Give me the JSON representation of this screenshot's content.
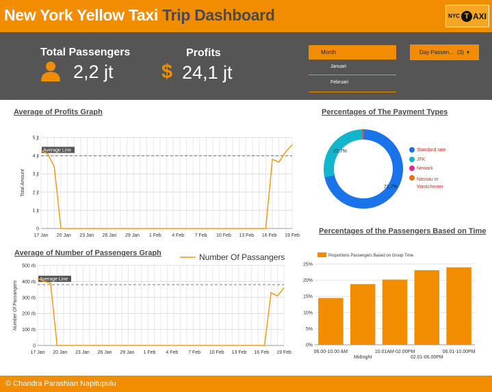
{
  "header": {
    "title_main": "New York Yellow Taxi",
    "title_accent": "Trip Dashboard",
    "logo_left": "NYC",
    "logo_t": "T",
    "logo_right": "AXI"
  },
  "kpis": {
    "passengers_label": "Total Passengers",
    "passengers_value": "2,2 jt",
    "profits_label": "Profits",
    "profits_symbol": "$",
    "profits_value": "24,1 jt"
  },
  "filters": {
    "month_label": "Month",
    "month_options": [
      "Januari",
      "Februari"
    ],
    "day_label": "Day Passen...",
    "day_count": "(3)",
    "day_arrow": "▾"
  },
  "sections": {
    "profits_title": "Average of Profits Graph",
    "passengers_title": "Average of Number of Passengers Graph",
    "payment_title": "Percentages of The Payment Types",
    "time_title": "Percentages of the Passengers Based on Time"
  },
  "payment_legend": [
    "Standard rate",
    "JFK",
    "Newark",
    "Nassau or Westchester"
  ],
  "colors": {
    "accent": "#f28c00",
    "band": "#555555",
    "line": "#f39c12",
    "bar": "#f28c00",
    "standard_rate": "#1a73e8",
    "jfk": "#12b5cb",
    "newark": "#e52592",
    "nassau": "#e8710a"
  },
  "footer": {
    "text": "© Chandra Parashian Napitupulu"
  },
  "chart_data": [
    {
      "type": "line",
      "ylabel": "Total Amount",
      "yticks": [
        "0",
        "1 jt",
        "2 jt",
        "3 jt",
        "4 jt",
        "5 jt"
      ],
      "ylim": [
        0,
        5
      ],
      "xticks": [
        "17 Jan",
        "20 Jan",
        "23 Jan",
        "26 Jan",
        "29 Jan",
        "1 Feb",
        "4 Feb",
        "7 Feb",
        "10 Feb",
        "13 Feb",
        "16 Feb",
        "19 Feb"
      ],
      "reference_line": {
        "label": "Average Line",
        "value": 4.0
      },
      "series": [
        {
          "values": [
            4.3,
            4.1,
            3.4,
            0,
            0,
            0,
            0,
            0,
            0,
            0,
            0,
            0,
            0,
            0,
            0,
            0,
            0,
            0,
            0,
            0,
            0,
            0,
            0,
            0,
            0,
            0,
            0,
            0,
            0,
            0,
            0,
            0,
            0,
            0,
            0,
            3.8,
            3.65,
            4.2,
            4.6
          ]
        }
      ],
      "grid": true
    },
    {
      "type": "line",
      "ylabel": "Number Of Passangers",
      "legend": [
        "Number Of Passangers"
      ],
      "yticks": [
        "0",
        "100 rb",
        "200 rb",
        "300 rb",
        "400 rb",
        "500 rb"
      ],
      "ylim": [
        0,
        500
      ],
      "xticks": [
        "17 Jan",
        "20 Jan",
        "23 Jan",
        "26 Jan",
        "29 Jan",
        "1 Feb",
        "4 Feb",
        "7 Feb",
        "10 Feb",
        "13 Feb",
        "16 Feb",
        "19 Feb"
      ],
      "reference_line": {
        "label": "Average Line",
        "value": 380
      },
      "series": [
        {
          "name": "Number Of Passangers",
          "values": [
            420,
            400,
            390,
            0,
            0,
            0,
            0,
            0,
            0,
            0,
            0,
            0,
            0,
            0,
            0,
            0,
            0,
            0,
            0,
            0,
            0,
            0,
            0,
            0,
            0,
            0,
            0,
            0,
            0,
            0,
            0,
            0,
            0,
            0,
            0,
            0,
            330,
            310,
            360
          ]
        }
      ],
      "grid": true
    },
    {
      "type": "pie",
      "categories": [
        "Standard rate",
        "JFK",
        "Newark",
        "Nassau or Westchester"
      ],
      "values": [
        71.7,
        27.7,
        0.4,
        0.2
      ],
      "data_labels": [
        "71,7%",
        "27,7%"
      ]
    },
    {
      "type": "bar",
      "legend": [
        "Proportions Passengers Based on Group Time"
      ],
      "categories": [
        "06.00-10.00 AM",
        "Midnight",
        "10.01AM-02.00PM",
        "02.01-06.00PM",
        "06.01-10.00PM"
      ],
      "values": [
        14.5,
        18.8,
        20.2,
        23.1,
        24.0
      ],
      "yticks": [
        "0%",
        "5%",
        "10%",
        "15%",
        "20%",
        "25%"
      ],
      "ylim": [
        0,
        25
      ]
    }
  ]
}
